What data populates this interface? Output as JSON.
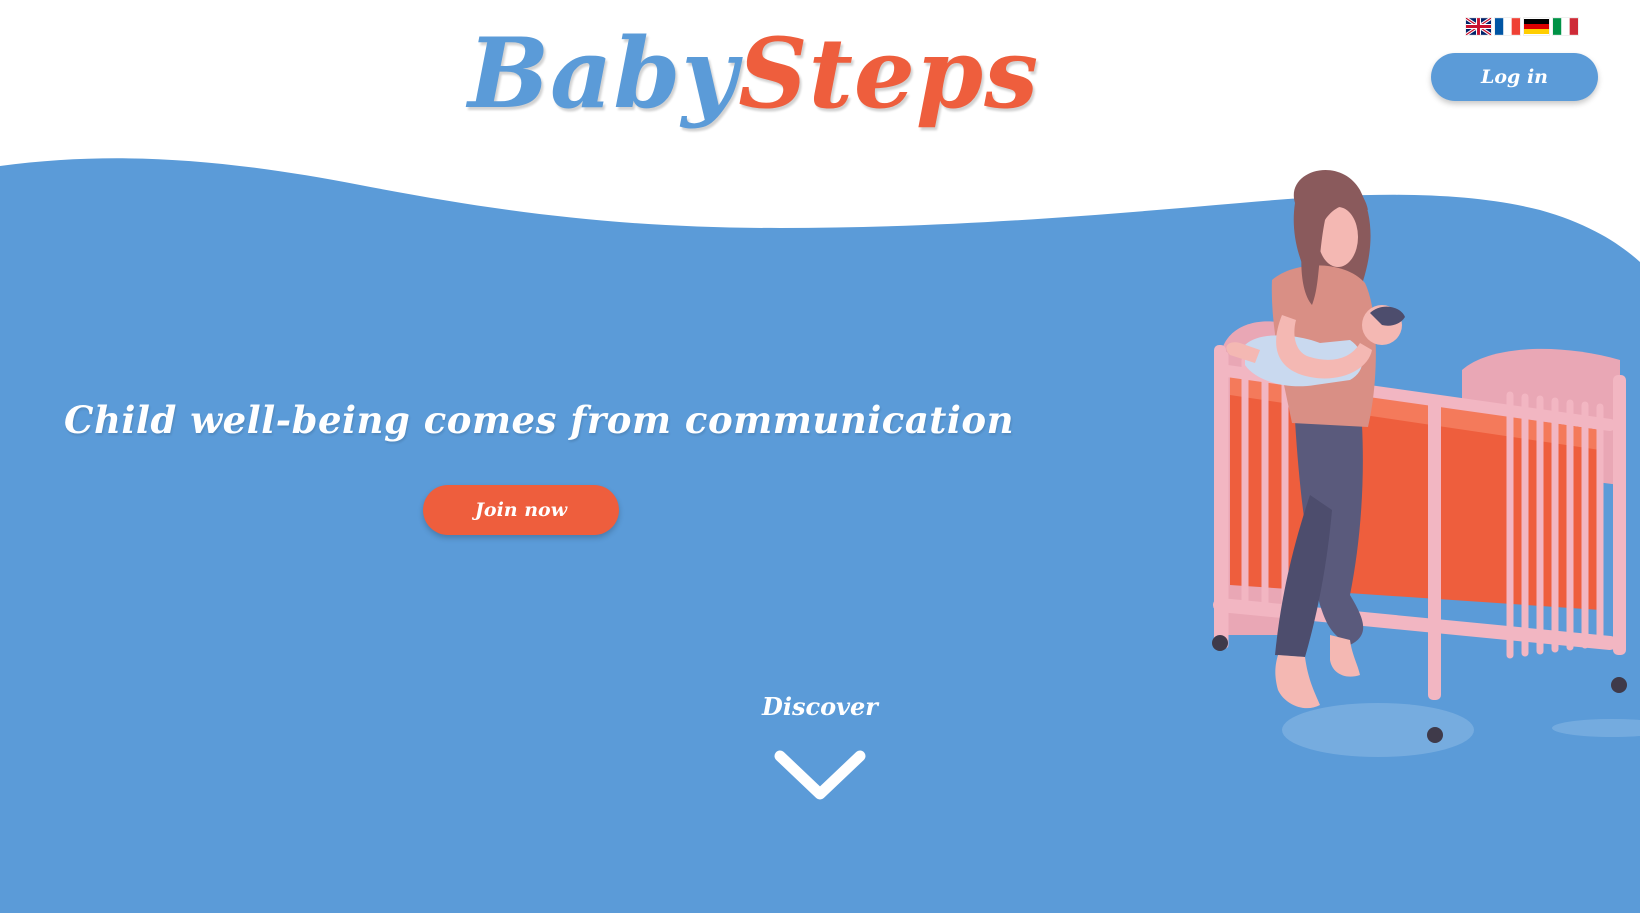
{
  "brand": {
    "logo_part1": "Baby",
    "logo_part2": "Steps",
    "blue": "#5b9bd8",
    "orange": "#ee5e3d"
  },
  "languages": [
    {
      "code": "en",
      "icon": "uk-flag-icon"
    },
    {
      "code": "fr",
      "icon": "france-flag-icon"
    },
    {
      "code": "de",
      "icon": "germany-flag-icon"
    },
    {
      "code": "it",
      "icon": "italy-flag-icon"
    }
  ],
  "header": {
    "login_label": "Log in"
  },
  "hero": {
    "title": "Child well-being comes from communication",
    "cta_label": "Join now",
    "discover_label": "Discover",
    "discover_icon": "chevron-down-icon",
    "illustration": "mother-holding-baby-by-crib-illustration"
  }
}
